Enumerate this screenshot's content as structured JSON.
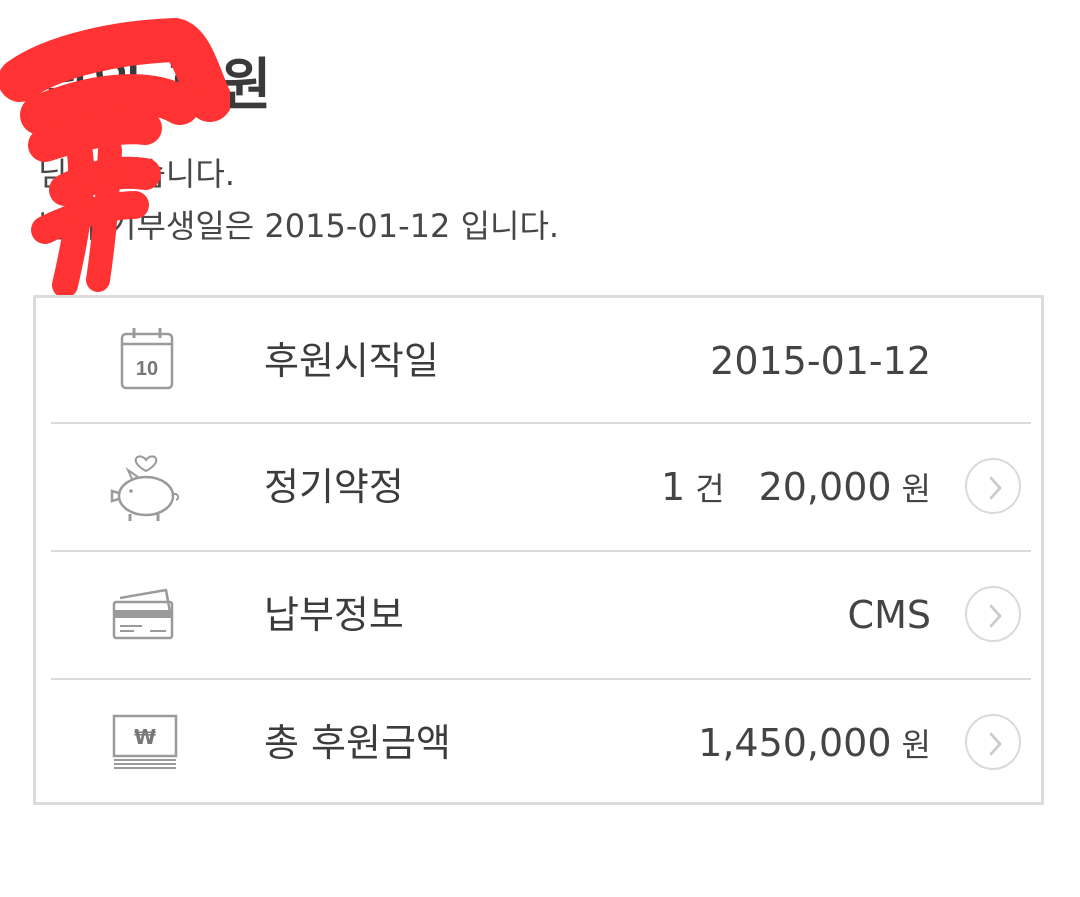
{
  "header": {
    "title": "님의 후원",
    "greeting_line1": "님 반갑습니다.",
    "greeting_line2": "님의 기부생일은 2015-01-12 입니다."
  },
  "summary": {
    "rows": [
      {
        "icon": "calendar-icon",
        "icon_text": "10",
        "label": "후원시작일",
        "value": "2015-01-12"
      },
      {
        "icon": "piggy-bank-icon",
        "label": "정기약정",
        "count": "1",
        "count_unit": "건",
        "amount": "20,000",
        "amount_unit": "원"
      },
      {
        "icon": "credit-card-icon",
        "label": "납부정보",
        "value": "CMS"
      },
      {
        "icon": "won-money-icon",
        "icon_text": "₩",
        "label": "총 후원금액",
        "amount": "1,450,000",
        "amount_unit": "원"
      }
    ]
  },
  "colors": {
    "redaction": "#ff3333",
    "border": "#dcdcdc",
    "text": "#3f3f3f"
  }
}
